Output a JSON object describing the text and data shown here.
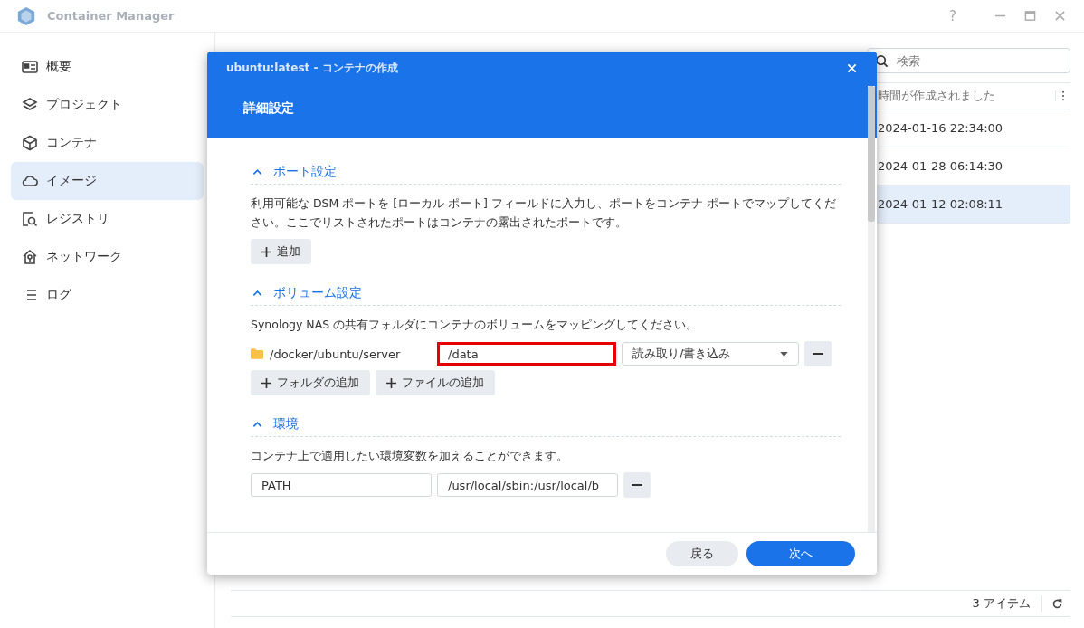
{
  "app": {
    "title": "Container Manager",
    "help": "?"
  },
  "sidebar": {
    "items": [
      {
        "label": "概要",
        "selected": false
      },
      {
        "label": "プロジェクト",
        "selected": false
      },
      {
        "label": "コンテナ",
        "selected": false
      },
      {
        "label": "イメージ",
        "selected": true
      },
      {
        "label": "レジストリ",
        "selected": false
      },
      {
        "label": "ネットワーク",
        "selected": false
      },
      {
        "label": "ログ",
        "selected": false
      }
    ]
  },
  "search": {
    "placeholder": "検索"
  },
  "table": {
    "columns": [
      "時間が作成されました"
    ],
    "rows": [
      {
        "cells": [
          "2024-01-16 22:34:00"
        ],
        "selected": false
      },
      {
        "cells": [
          "2024-01-28 06:14:30"
        ],
        "selected": false
      },
      {
        "cells": [
          "2024-01-12 02:08:11"
        ],
        "selected": true
      }
    ]
  },
  "status_bar": {
    "count": "3 アイテム"
  },
  "dialog": {
    "title": "ubuntu:latest - コンテナの作成",
    "subtitle": "詳細設定",
    "sections": [
      {
        "kind": "ports",
        "title": "ポート設定",
        "expanded": true,
        "description": "利用可能な DSM ポートを [ローカル ポート] フィールドに入力し、ポートをコンテナ ポートでマップしてください。ここでリストされたポートはコンテナの露出されたポートです。",
        "buttons": [
          "追加"
        ]
      },
      {
        "kind": "volumes",
        "title": "ボリューム設定",
        "expanded": true,
        "description": "Synology NAS の共有フォルダにコンテナのボリュームをマッピングしてください。",
        "rows": [
          {
            "folder": "/docker/ubuntu/server",
            "mount": "/data",
            "highlighted": true,
            "mode": "読み取り/書き込み"
          }
        ],
        "buttons": [
          "フォルダの追加",
          "ファイルの追加"
        ]
      },
      {
        "kind": "env",
        "title": "環境",
        "expanded": true,
        "description": "コンテナ上で適用したい環境変数を加えることができます。",
        "rows": [
          {
            "name": "PATH",
            "value": "/usr/local/sbin:/usr/local/b"
          }
        ]
      }
    ],
    "buttons": [
      {
        "label": "戻る",
        "primary": false
      },
      {
        "label": "次へ",
        "primary": true
      }
    ]
  }
}
